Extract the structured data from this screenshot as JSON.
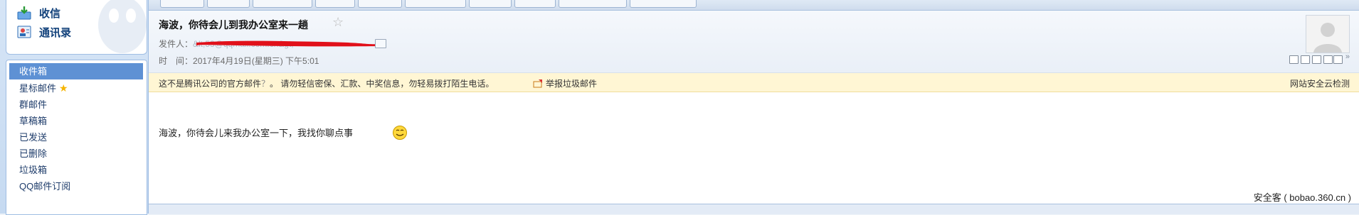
{
  "sidebar": {
    "inbox_label": "收信",
    "contacts_label": "通讯录",
    "folders": [
      {
        "label": "收件箱",
        "active": true
      },
      {
        "label": "星标邮件",
        "icon": "star-icon"
      },
      {
        "label": "群邮件"
      },
      {
        "label": "草稿箱"
      },
      {
        "label": "已发送"
      },
      {
        "label": "已删除"
      },
      {
        "label": "垃圾箱"
      },
      {
        "label": "QQ邮件订阅"
      }
    ]
  },
  "mail": {
    "subject": "海波，你待会儿到我办公室来一趟",
    "sender_label": "发件人：",
    "sender_value": "&lt;53@qqmail.com.cn&gt;",
    "time_label": "时　间：",
    "time_value": "2017年4月19日(星期三) 下午5:01",
    "body": "海波，你待会儿来我办公室一下，我找你聊点事"
  },
  "warning": {
    "text": "这不是腾讯公司的官方邮件",
    "help_icon": "？",
    "advice": "。  请勿轻信密保、汇款、中奖信息，勿轻易拨打陌生电话。",
    "report_label": "举报垃圾邮件",
    "cloud_check_label": "网站安全云检测"
  },
  "watermark": "安全客 ( bobao.360.cn )",
  "colors": {
    "accent": "#5e91d4",
    "redaction": "#e1101a",
    "warning_bg": "#fff6d4"
  }
}
